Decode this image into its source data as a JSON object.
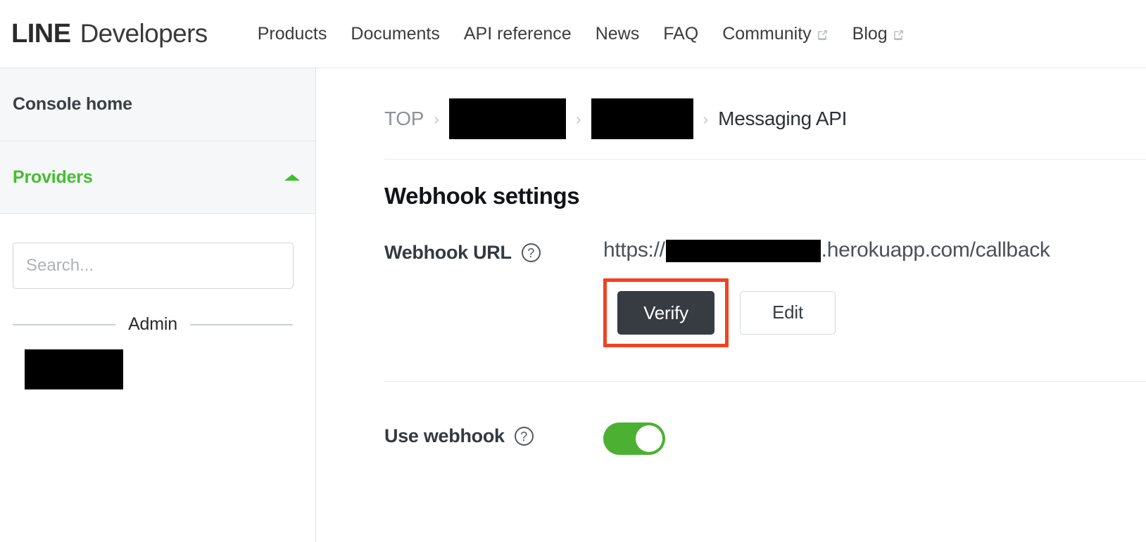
{
  "header": {
    "logo_primary": "LINE",
    "logo_secondary": "Developers",
    "nav": [
      {
        "label": "Products",
        "external": false
      },
      {
        "label": "Documents",
        "external": false
      },
      {
        "label": "API reference",
        "external": false
      },
      {
        "label": "News",
        "external": false
      },
      {
        "label": "FAQ",
        "external": false
      },
      {
        "label": "Community",
        "external": true
      },
      {
        "label": "Blog",
        "external": true
      }
    ]
  },
  "sidebar": {
    "console_home": "Console home",
    "providers": "Providers",
    "providers_expanded_icon": "chevron-up-icon",
    "search": {
      "placeholder": "Search...",
      "value": ""
    },
    "admin_divider_label": "Admin",
    "admin_item_redacted": ""
  },
  "breadcrumb": {
    "items": [
      {
        "label": "TOP",
        "redacted": false,
        "current": false
      },
      {
        "label": "",
        "redacted": true,
        "current": false
      },
      {
        "label": "",
        "redacted": true,
        "current": false
      },
      {
        "label": "Messaging API",
        "redacted": false,
        "current": true
      }
    ],
    "separator": "›"
  },
  "main": {
    "section_title": "Webhook settings",
    "webhook_url": {
      "label": "Webhook URL",
      "help_icon": "question-mark-circle-icon",
      "url_prefix": "https://",
      "url_redacted": "",
      "url_suffix": ".herokuapp.com/callback",
      "verify_button": "Verify",
      "edit_button": "Edit"
    },
    "use_webhook": {
      "label": "Use webhook",
      "help_icon": "question-mark-circle-icon",
      "toggle_state": "on"
    }
  },
  "colors": {
    "brand_green": "#46bd31",
    "toggle_green": "#4cb033",
    "highlight_red": "#ef4323",
    "verify_dark": "#363c41",
    "sidebar_row_bg": "#f5f7f8",
    "redaction_black": "#000000"
  }
}
